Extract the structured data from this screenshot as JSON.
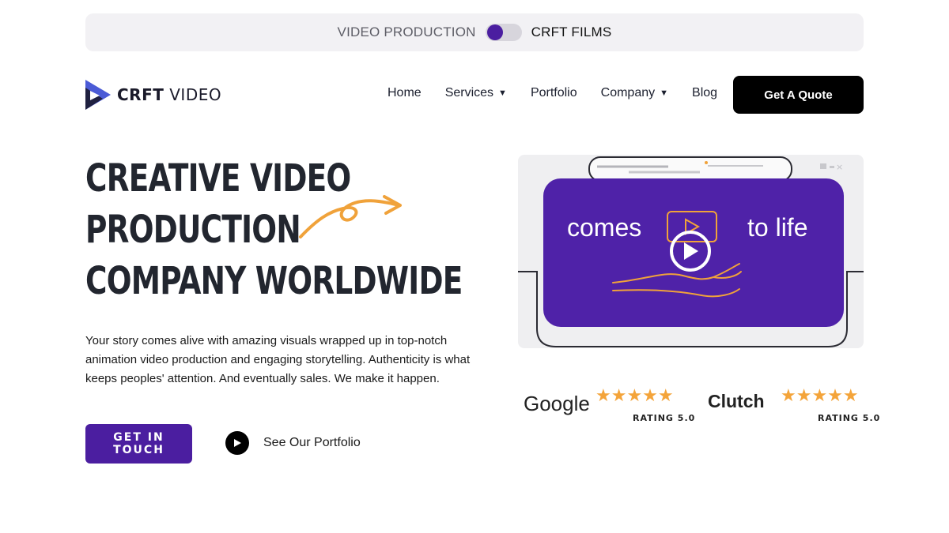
{
  "topbar": {
    "left_label": "VIDEO PRODUCTION",
    "right_label": "CRFT FILMS"
  },
  "header": {
    "logo_bold": "CRFT",
    "logo_light": "VIDEO",
    "nav": [
      {
        "label": "Home"
      },
      {
        "label": "Services"
      },
      {
        "label": "Portfolio"
      },
      {
        "label": "Company"
      },
      {
        "label": "Blog"
      }
    ],
    "quote_button": "Get A Quote"
  },
  "hero": {
    "title_lines": [
      "CREATIVE VIDEO",
      "PRODUCTION",
      "COMPANY WORLDWIDE"
    ],
    "description": "Your story comes alive with amazing visuals wrapped up in top-notch animation video production and engaging storytelling. Authenticity is what keeps peoples' attention. And eventually sales. We make it happen.",
    "cta": "GET IN TOUCH",
    "portfolio_link": "See Our Portfolio"
  },
  "video": {
    "word_left": "comes",
    "word_right": "to life"
  },
  "ratings": [
    {
      "brand": "Google",
      "stars": "★★★★★",
      "text": "RATING 5.0"
    },
    {
      "brand": "Clutch",
      "stars": "★★★★★",
      "text": "RATING 5.0"
    }
  ],
  "colors": {
    "accent": "#4b1ea0",
    "star": "#f4a43a",
    "arrow": "#f0a23a"
  }
}
